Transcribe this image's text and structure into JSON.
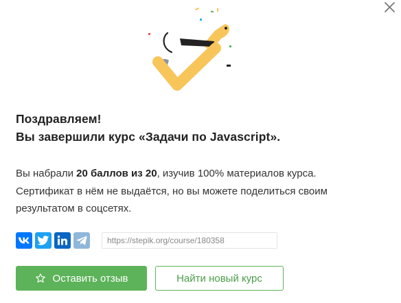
{
  "dialog": {
    "close_icon": "close-icon",
    "illustration": "checkmark-dog-illustration",
    "title_line1": "Поздравляем!",
    "title_line2": "Вы завершили курс «Задачи по Javascript».",
    "body": {
      "line1_prefix": "Вы набрали ",
      "line1_score": "20 баллов из 20",
      "line1_suffix": ", изучив 100% материалов курса.",
      "line2": "Сертификат в нём не выдаётся, но вы можете поделиться своим",
      "line3": "результатом в соцсетях."
    },
    "share": {
      "buttons": [
        {
          "icon": "vk-icon",
          "color": "#0077ff"
        },
        {
          "icon": "twitter-icon",
          "color": "#1da1f2"
        },
        {
          "icon": "linkedin-icon",
          "color": "#0a66c2"
        },
        {
          "icon": "telegram-icon",
          "color": "#8fb7d9"
        }
      ],
      "url": "https://stepik.org/course/180358"
    },
    "actions": {
      "review_label": "Оставить отзыв",
      "review_icon": "star-icon",
      "find_course_label": "Найти новый курс"
    },
    "colors": {
      "accent_green": "#5db35a",
      "check_yellow": "#f7c55a"
    }
  }
}
